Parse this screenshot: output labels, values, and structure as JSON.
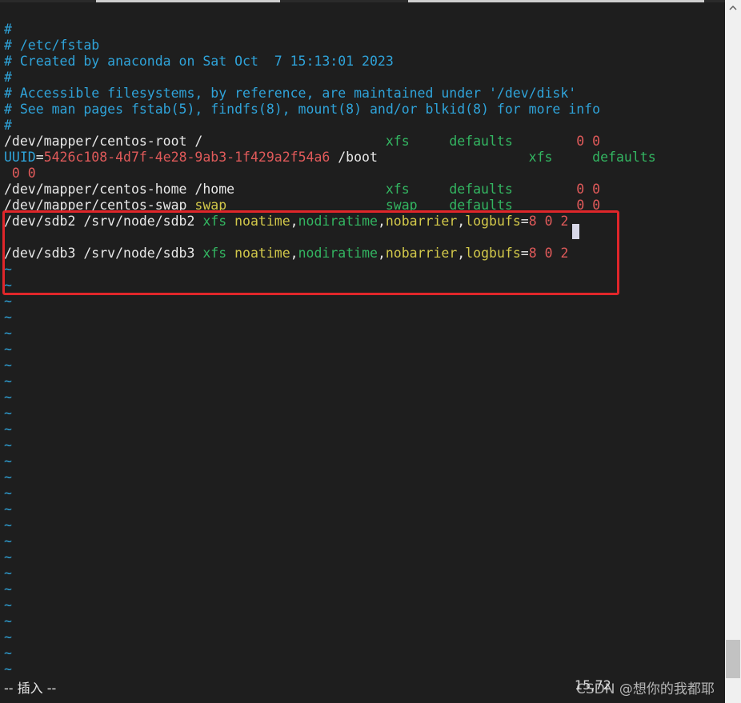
{
  "lines": [
    [
      {
        "t": "#",
        "c": "comment"
      }
    ],
    [
      {
        "t": "# /etc/fstab",
        "c": "comment"
      }
    ],
    [
      {
        "t": "# Created by anaconda on Sat Oct  7 15:13:01 2023",
        "c": "comment"
      }
    ],
    [
      {
        "t": "#",
        "c": "comment"
      }
    ],
    [
      {
        "t": "# Accessible filesystems, by reference, are maintained under '/dev/disk'",
        "c": "comment"
      }
    ],
    [
      {
        "t": "# See man pages fstab(5), findfs(8), mount(8) and/or blkid(8) for more info",
        "c": "comment"
      }
    ],
    [
      {
        "t": "#",
        "c": "comment"
      }
    ],
    [
      {
        "t": "/dev/mapper/centos-root /                       ",
        "c": "white"
      },
      {
        "t": "xfs",
        "c": "green"
      },
      {
        "t": "     ",
        "c": "white"
      },
      {
        "t": "defaults",
        "c": "green"
      },
      {
        "t": "        ",
        "c": "white"
      },
      {
        "t": "0 0",
        "c": "red"
      }
    ],
    [
      {
        "t": "UUID",
        "c": "comment"
      },
      {
        "t": "=",
        "c": "white"
      },
      {
        "t": "5426c108-4d7f-4e28-9ab3-1f429a2f54a6",
        "c": "red"
      },
      {
        "t": " /boot                   ",
        "c": "white"
      },
      {
        "t": "xfs",
        "c": "green"
      },
      {
        "t": "     ",
        "c": "white"
      },
      {
        "t": "defaults",
        "c": "green"
      }
    ],
    [
      {
        "t": " 0 0",
        "c": "red"
      }
    ],
    [
      {
        "t": "/dev/mapper/centos-home /home                   ",
        "c": "white"
      },
      {
        "t": "xfs",
        "c": "green"
      },
      {
        "t": "     ",
        "c": "white"
      },
      {
        "t": "defaults",
        "c": "green"
      },
      {
        "t": "        ",
        "c": "white"
      },
      {
        "t": "0 0",
        "c": "red"
      }
    ],
    [
      {
        "t": "/dev/mapper/centos-swap ",
        "c": "white"
      },
      {
        "t": "swap",
        "c": "yellow"
      },
      {
        "t": "                    ",
        "c": "white"
      },
      {
        "t": "swap",
        "c": "green"
      },
      {
        "t": "    ",
        "c": "white"
      },
      {
        "t": "defaults",
        "c": "green"
      },
      {
        "t": "        ",
        "c": "white"
      },
      {
        "t": "0 0",
        "c": "red"
      }
    ],
    [
      {
        "t": "/dev/sdb2 /srv/node/sdb2 ",
        "c": "white"
      },
      {
        "t": "xfs",
        "c": "green"
      },
      {
        "t": " ",
        "c": "white"
      },
      {
        "t": "noatime",
        "c": "yellow"
      },
      {
        "t": ",",
        "c": "white"
      },
      {
        "t": "nodiratime",
        "c": "green"
      },
      {
        "t": ",",
        "c": "white"
      },
      {
        "t": "nobarrier",
        "c": "yellow"
      },
      {
        "t": ",",
        "c": "white"
      },
      {
        "t": "logbufs",
        "c": "yellow"
      },
      {
        "t": "=",
        "c": "white"
      },
      {
        "t": "8 0 2",
        "c": "red"
      }
    ],
    [
      {
        "t": "",
        "c": "white"
      }
    ],
    [
      {
        "t": "/dev/sdb3 /srv/node/sdb3 ",
        "c": "white"
      },
      {
        "t": "xfs",
        "c": "green"
      },
      {
        "t": " ",
        "c": "white"
      },
      {
        "t": "noatime",
        "c": "yellow"
      },
      {
        "t": ",",
        "c": "white"
      },
      {
        "t": "nodiratime",
        "c": "green"
      },
      {
        "t": ",",
        "c": "white"
      },
      {
        "t": "nobarrier",
        "c": "yellow"
      },
      {
        "t": ",",
        "c": "white"
      },
      {
        "t": "logbufs",
        "c": "yellow"
      },
      {
        "t": "=",
        "c": "white"
      },
      {
        "t": "8 0 2",
        "c": "red"
      }
    ]
  ],
  "tilde_char": "~",
  "tilde_count": 26,
  "status": {
    "mode": "-- 插入 --",
    "position": "15,72"
  },
  "watermark": "CSDN @想你的我都耶",
  "colors": {
    "background": "#1e1e1e",
    "comment": "#2fa3d9",
    "green": "#33b561",
    "yellow": "#d2c84a",
    "red": "#e05a5a",
    "highlight_box": "#e0262a"
  }
}
